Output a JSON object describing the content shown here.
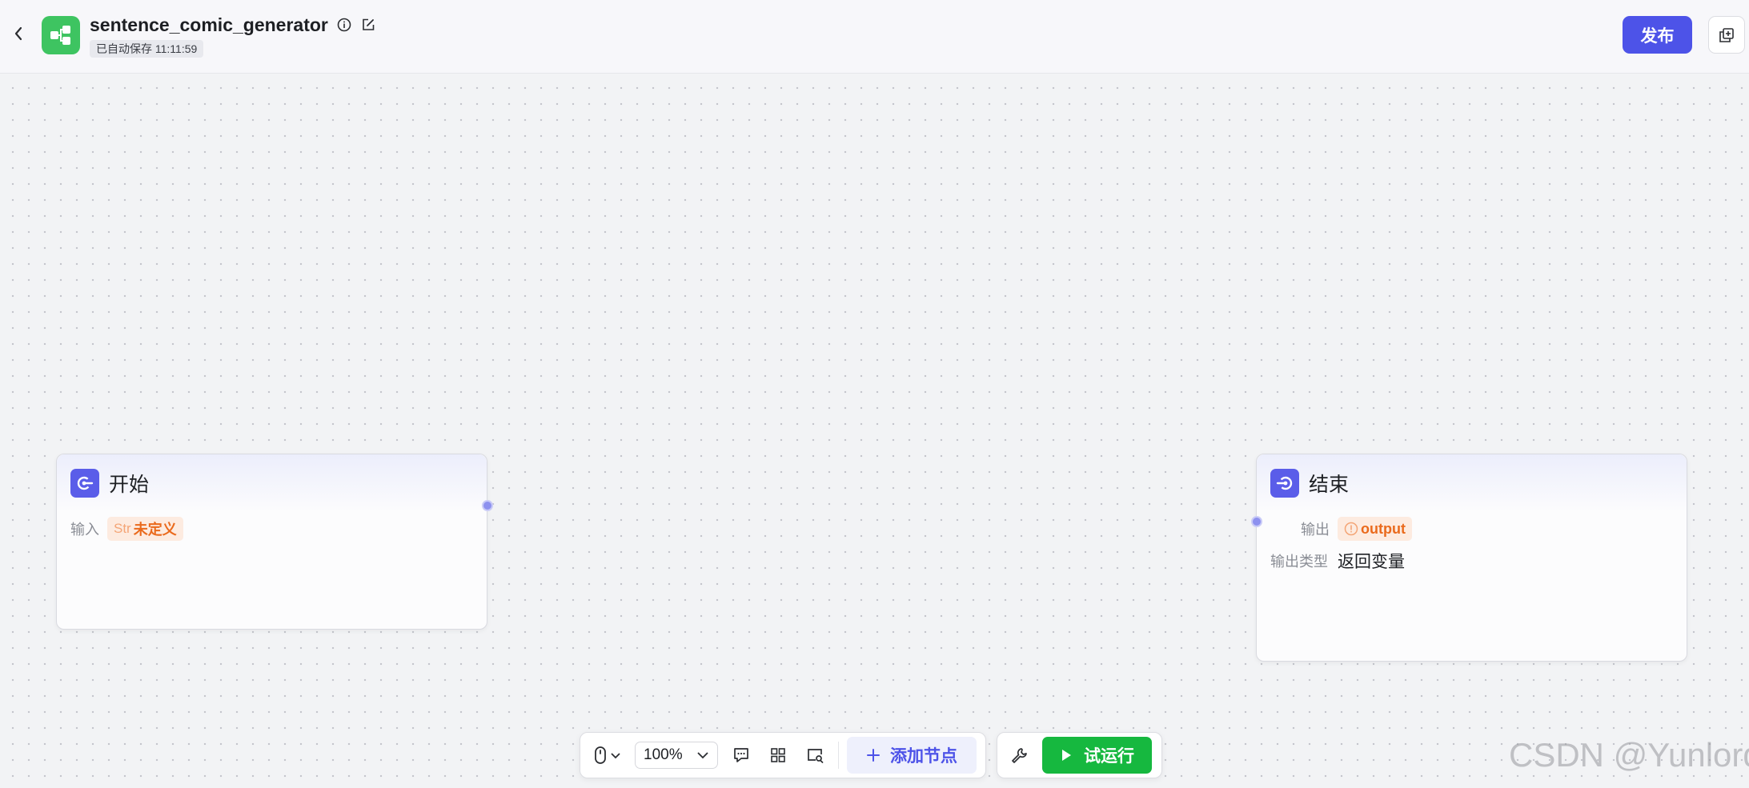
{
  "header": {
    "app_name": "sentence_comic_generator",
    "autosave_label": "已自动保存 11:11:59",
    "publish_label": "发布"
  },
  "nodes": {
    "start": {
      "title": "开始",
      "input_label": "输入",
      "input_type": "Str",
      "input_value": "未定义"
    },
    "end": {
      "title": "结束",
      "output_label": "输出",
      "output_value": "output",
      "output_type_label": "输出类型",
      "output_type_value": "返回变量"
    }
  },
  "toolbar": {
    "zoom_level": "100%",
    "add_node_label": "添加节点",
    "test_run_label": "试运行"
  },
  "watermark": "CSDN @Yunlord",
  "colors": {
    "accent": "#4d53e8",
    "app_icon": "#3ec461",
    "run_button": "#16b83f",
    "warning_tag": "#ea6a1c"
  }
}
